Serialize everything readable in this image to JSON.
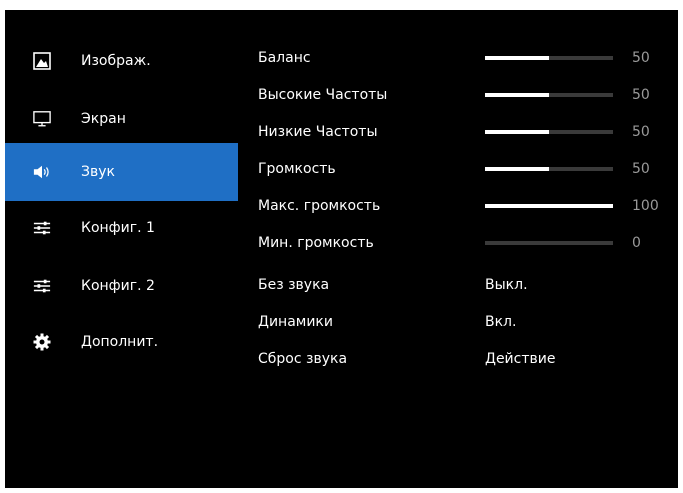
{
  "colors": {
    "background": "#000000",
    "accent": "#1f6fc5",
    "text": "#ffffff",
    "value_text": "#9a9a9a",
    "track": "#3a3a3a"
  },
  "sidebar": {
    "items": [
      {
        "label": "Изображ.",
        "icon": "picture-icon",
        "active": false
      },
      {
        "label": "Экран",
        "icon": "monitor-icon",
        "active": false
      },
      {
        "label": "Звук",
        "icon": "speaker-icon",
        "active": true
      },
      {
        "label": "Конфиг. 1",
        "icon": "sliders-icon",
        "active": false
      },
      {
        "label": "Конфиг. 2",
        "icon": "sliders-icon",
        "active": false
      },
      {
        "label": "Дополнит.",
        "icon": "gear-icon",
        "active": false
      }
    ]
  },
  "settings": [
    {
      "label": "Баланс",
      "type": "slider",
      "value": 50,
      "max": 100
    },
    {
      "label": "Высокие Частоты",
      "type": "slider",
      "value": 50,
      "max": 100
    },
    {
      "label": "Низкие Частоты",
      "type": "slider",
      "value": 50,
      "max": 100
    },
    {
      "label": "Громкость",
      "type": "slider",
      "value": 50,
      "max": 100
    },
    {
      "label": "Макс. громкость",
      "type": "slider",
      "value": 100,
      "max": 100
    },
    {
      "label": "Мин. громкость",
      "type": "slider",
      "value": 0,
      "max": 100
    },
    {
      "label": "Без звука",
      "type": "option",
      "value": "Выкл."
    },
    {
      "label": "Динамики",
      "type": "option",
      "value": "Вкл."
    },
    {
      "label": "Сброс звука",
      "type": "option",
      "value": "Действие"
    }
  ]
}
